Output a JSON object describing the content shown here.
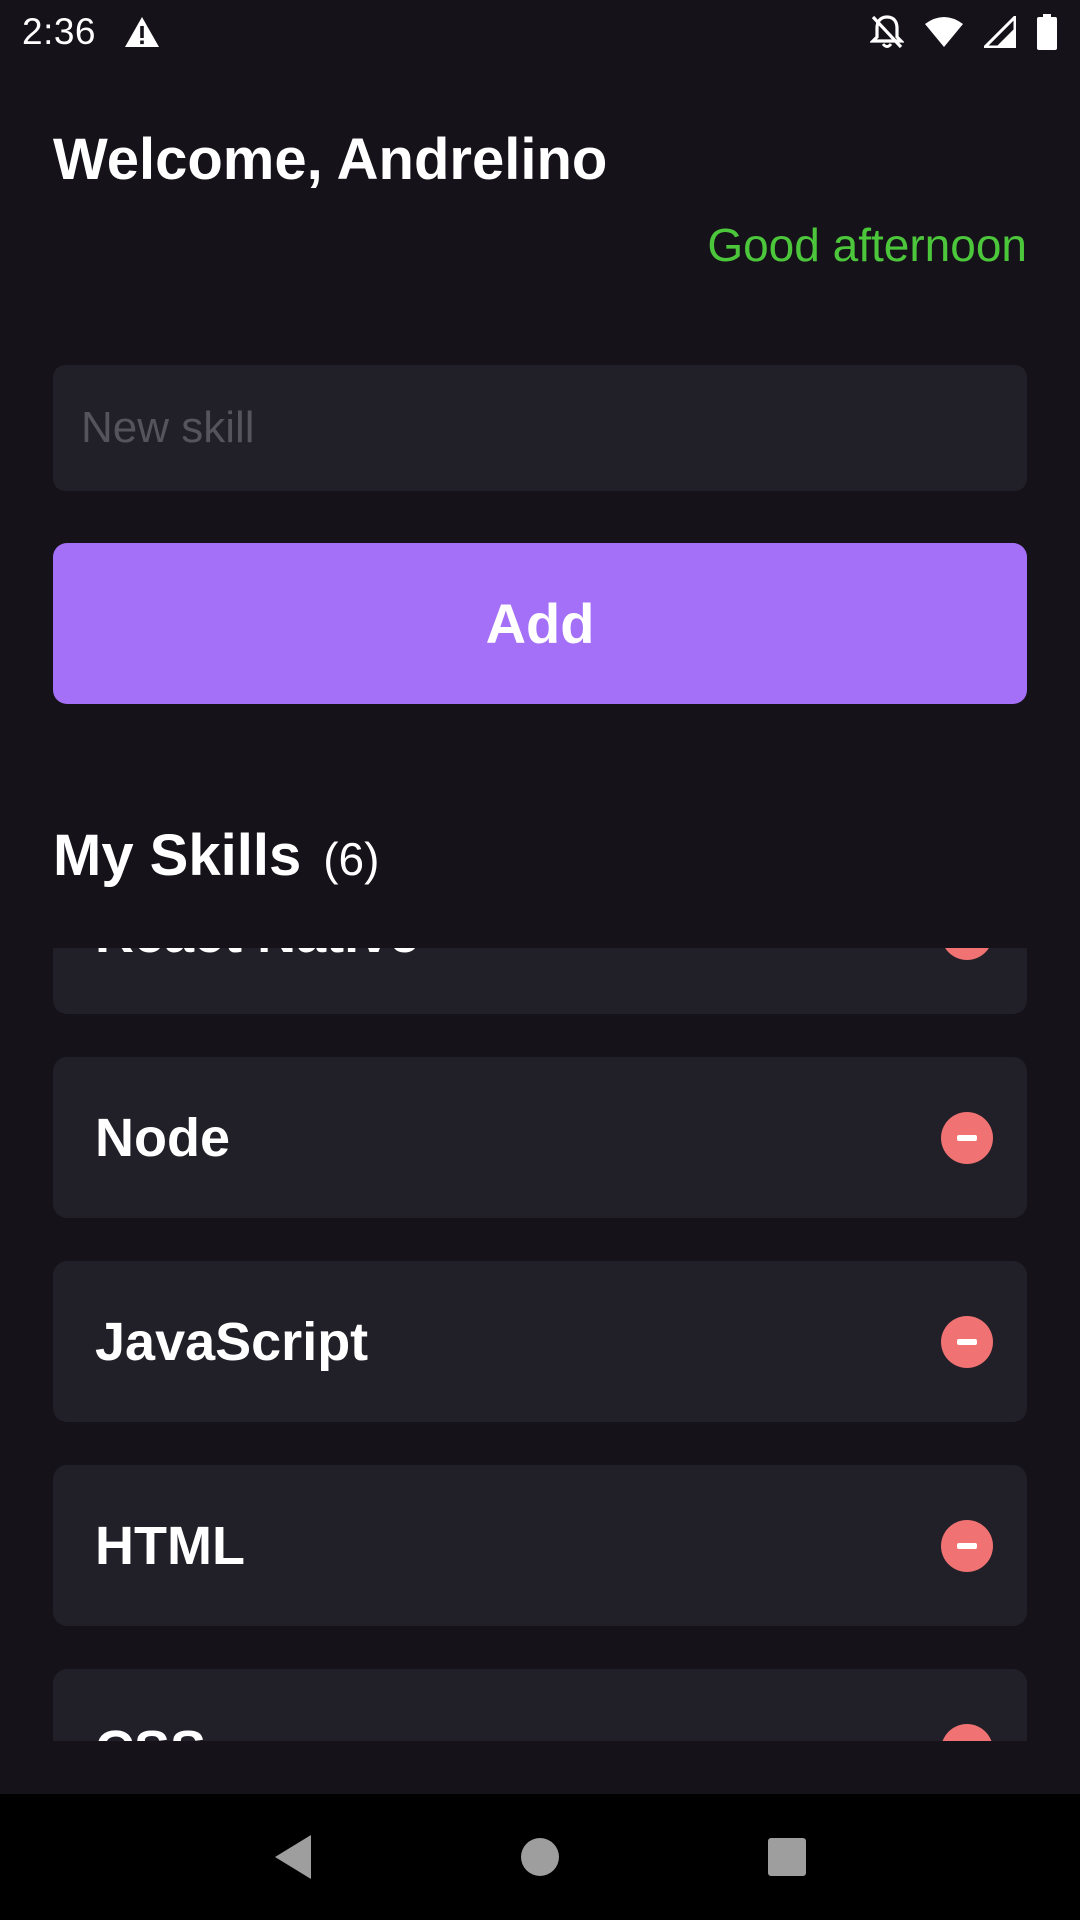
{
  "status_bar": {
    "time": "2:36",
    "icons": [
      "warning-icon",
      "notifications-off-icon",
      "wifi-icon",
      "signal-icon",
      "battery-icon"
    ]
  },
  "header": {
    "welcome": "Welcome, Andrelino",
    "greeting": "Good afternoon"
  },
  "input": {
    "placeholder": "New skill",
    "value": ""
  },
  "add_button": {
    "label": "Add"
  },
  "skills_section": {
    "title": "My Skills",
    "count": "(6)",
    "items": [
      {
        "name": "React Native"
      },
      {
        "name": "Node"
      },
      {
        "name": "JavaScript"
      },
      {
        "name": "HTML"
      },
      {
        "name": "CSS"
      }
    ]
  },
  "colors": {
    "background": "#15121a",
    "card": "#211f27",
    "accent": "#a370f7",
    "greeting": "#4cc63a",
    "remove": "#f07272"
  },
  "nav_bar": {
    "icons": [
      "back-icon",
      "home-icon",
      "recents-icon"
    ]
  }
}
